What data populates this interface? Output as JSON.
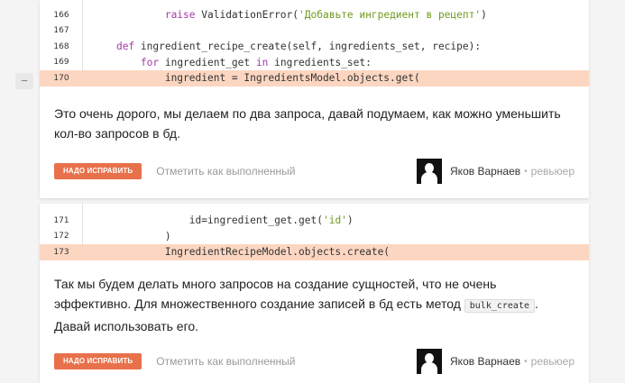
{
  "threads": [
    {
      "collapse_label": "−",
      "code_lines": [
        {
          "num": "166",
          "indent": "            ",
          "parts": [
            {
              "t": "raise",
              "c": "kw"
            },
            {
              "t": " ValidationError(",
              "c": ""
            },
            {
              "t": "'Добавьте ингредиент в рецепт'",
              "c": "str"
            },
            {
              "t": ")",
              "c": ""
            }
          ],
          "highlight": false
        },
        {
          "num": "167",
          "indent": "",
          "parts": [],
          "highlight": false
        },
        {
          "num": "168",
          "indent": "    ",
          "parts": [
            {
              "t": "def",
              "c": "kw"
            },
            {
              "t": " ingredient_recipe_create(self, ingredients_set, recipe):",
              "c": ""
            }
          ],
          "highlight": false
        },
        {
          "num": "169",
          "indent": "        ",
          "parts": [
            {
              "t": "for",
              "c": "kw"
            },
            {
              "t": " ingredient_get ",
              "c": ""
            },
            {
              "t": "in",
              "c": "kw"
            },
            {
              "t": " ingredients_set:",
              "c": ""
            }
          ],
          "highlight": false
        },
        {
          "num": "170",
          "indent": "            ",
          "parts": [
            {
              "t": "ingredient = IngredientsModel.objects.get(",
              "c": ""
            }
          ],
          "highlight": true
        }
      ],
      "comment_text": "Это очень дорого, мы делаем по два запроса, давай подумаем, как можно уменьшить кол-во запросов в бд.",
      "fix_label": "НАДО ИСПРАВИТЬ",
      "mark_done_label": "Отметить как выполненный",
      "author": "Яков Варнаев",
      "role": "ревьюер"
    },
    {
      "code_lines": [
        {
          "num": "171",
          "indent": "                ",
          "parts": [
            {
              "t": "id=ingredient_get.get(",
              "c": ""
            },
            {
              "t": "'id'",
              "c": "str"
            },
            {
              "t": ")",
              "c": ""
            }
          ],
          "highlight": false
        },
        {
          "num": "172",
          "indent": "            ",
          "parts": [
            {
              "t": ")",
              "c": ""
            }
          ],
          "highlight": false
        },
        {
          "num": "173",
          "indent": "            ",
          "parts": [
            {
              "t": "IngredientRecipeModel.objects.create(",
              "c": ""
            }
          ],
          "highlight": true
        }
      ],
      "comment_before": "Так мы будем делать много запросов на создание сущностей, что не очень эффективно. Для множественного создание записей в бд есть метод ",
      "comment_code": "bulk_create",
      "comment_after": ". Давай использовать его.",
      "fix_label": "НАДО ИСПРАВИТЬ",
      "mark_done_label": "Отметить как выполненный",
      "author": "Яков Варнаев",
      "role": "ревьюер"
    }
  ],
  "icons": {
    "avatar": "user-silhouette-icon",
    "collapse": "minus-icon"
  },
  "colors": {
    "highlight": "#fcd6c1",
    "fix_badge": "#e8714b",
    "keyword": "#a53aa4",
    "string": "#6f9a1d"
  }
}
